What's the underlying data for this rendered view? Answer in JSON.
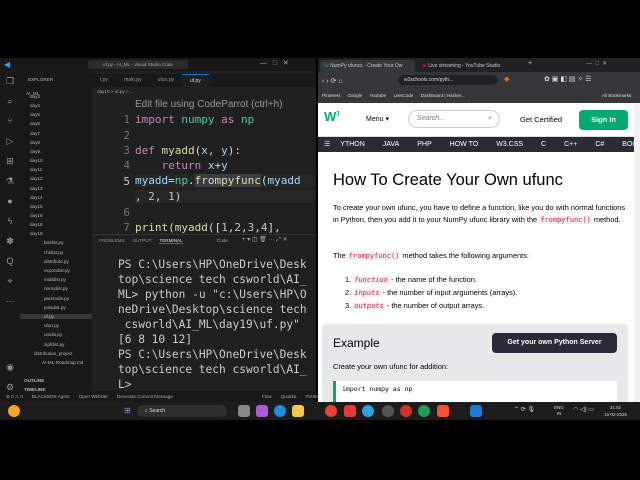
{
  "vscode": {
    "title": "uf.py - AI_ML - Visual Studio Code",
    "explorer_label": "EXPLORER",
    "root": "AI_ML",
    "folders": [
      "day3",
      "day4",
      "day5",
      "day6",
      "day7",
      "day8",
      "day9",
      "day10",
      "day11",
      "day12",
      "day13",
      "day14",
      "day15",
      "day16",
      "day18"
    ],
    "open_folder": "day19",
    "files": [
      "bindist.py",
      "chidist.py",
      "distribute.py",
      "expondist.py",
      "multdist.py",
      "normdist.py",
      "paretodis.py",
      "poisdist.py",
      "uf.py",
      "ufun.py",
      "unidis.py",
      "zipfdist.py"
    ],
    "after": [
      "distribution_project",
      "AI-ML-Roadmap.md"
    ],
    "outline": "OUTLINE",
    "timeline": "TIMELINE",
    "tabs": [
      "t.py",
      "main.py",
      "ufun.py",
      "uf.py"
    ],
    "breadcrumb": "day19 > uf.py > ...",
    "hint": "Edit file using CodeParrot (ctrl+h)",
    "line_numbers": [
      "1",
      "2",
      "3",
      "4",
      "5",
      "6",
      "7"
    ],
    "panel_tabs": [
      "PROBLEMS",
      "OUTPUT",
      "TERMINAL"
    ],
    "terminal_profile": "Code",
    "terminal_lines": [
      "PS C:\\Users\\HP\\OneDrive\\Desk",
      "top\\science tech csworld\\AI_",
      "ML> python -u \"c:\\Users\\HP\\O",
      "neDrive\\Desktop\\science tech",
      " csworld\\AI_ML\\day19\\uf.py\"",
      "[6 8 10 12]",
      "PS C:\\Users\\HP\\OneDrive\\Desk",
      "top\\science tech csworld\\AI_",
      "L> "
    ],
    "status": [
      "⊗ 0 ⚠ 0",
      "BLACKBOX Agent",
      "Open Website",
      "Generate Commit Message",
      "Flow",
      "Quokka",
      "Prettier"
    ]
  },
  "browser": {
    "tabs": [
      "NumPy ufuncs - Create Your Ow",
      "Live streaming - YouTube Studio"
    ],
    "url": "w3schools.com/pyth...",
    "bookmarks": [
      "Pinterest",
      "Google",
      "Youtube",
      "LeetCode",
      "Dashboard | Hacker...",
      "All Bookmarks"
    ],
    "menu": "Menu ▾",
    "search_placeholder": "Search...",
    "get_certified": "Get Certified",
    "sign_in": "Sign In",
    "nav": [
      "YTHON",
      "JAVA",
      "PHP",
      "HOW TO",
      "W3.CSS",
      "C",
      "C++",
      "C#",
      "BOO"
    ],
    "h1": "How To Create Your Own ufunc",
    "p1a": "To create your own ufunc, you have to define a function, like you do with normal functions in Python, then you add it to your NumPy ufunc library with the ",
    "p1code": "frompyfunc()",
    "p1b": " method.",
    "p2a": "The ",
    "p2code": "frompyfunc()",
    "p2b": " method takes the following arguments:",
    "args": [
      {
        "n": "1.",
        "code": "function",
        "text": " - the name of the function."
      },
      {
        "n": "2.",
        "code": "inputs",
        "text": " - the number of input arguments (arrays)."
      },
      {
        "n": "3.",
        "code": "outputs",
        "text": " - the number of output arrays."
      }
    ],
    "example": "Example",
    "server_button": "Get your own Python Server",
    "example_desc": "Create your own ufunc for addition:",
    "example_code": "import numpy as np"
  },
  "taskbar": {
    "search": "Search",
    "lang": "ENG\nIN",
    "time": "21:52",
    "date": "18-02-2026"
  }
}
